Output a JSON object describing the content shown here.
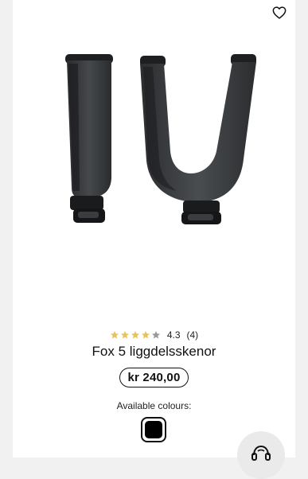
{
  "product": {
    "name": "Fox 5 liggdelsskenor",
    "rating_value": "4.3",
    "rating_count": "(4)",
    "rating_stars": 4.3,
    "price": "kr 240,00",
    "available_colours_label": "Available colours:",
    "colours": [
      {
        "name": "black",
        "hex": "#000000",
        "selected": true
      }
    ]
  },
  "icons": {
    "wishlist": "heart-outline-icon",
    "support": "headset-icon"
  },
  "colors": {
    "star_filled": "#e8c357",
    "star_empty": "#9a9a9a",
    "page_bg": "#f1f1f1"
  }
}
